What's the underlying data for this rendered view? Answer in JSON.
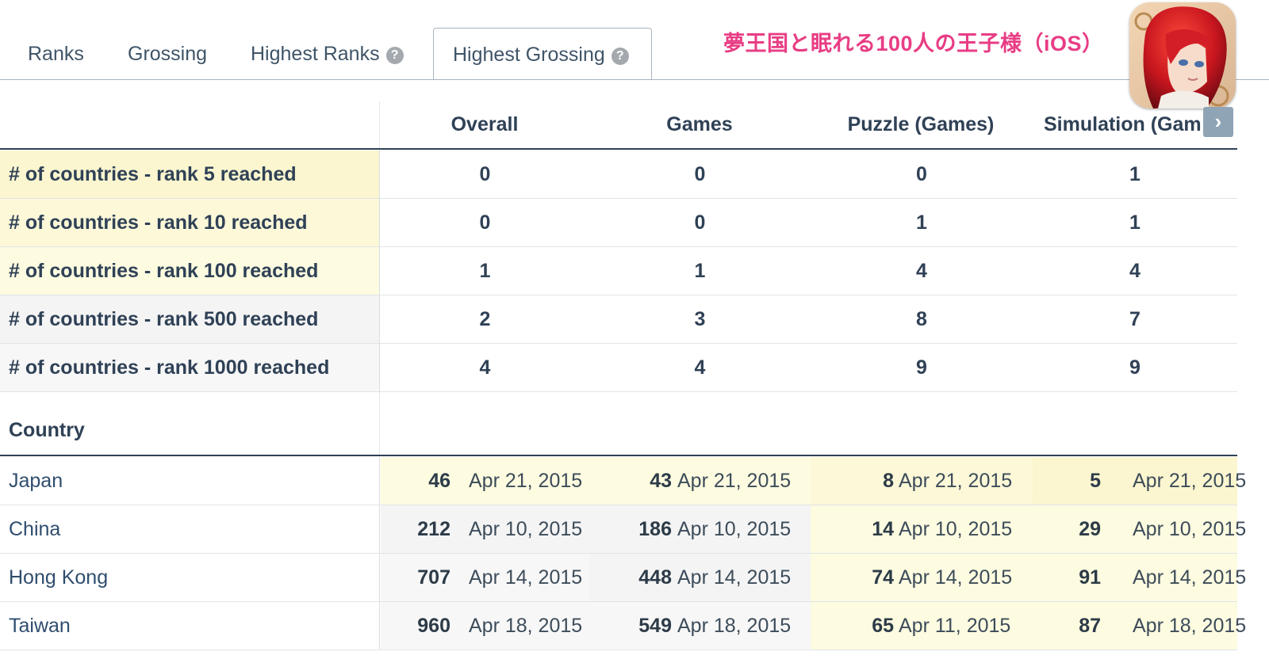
{
  "tabs": [
    {
      "label": "Ranks",
      "help": false,
      "active": false
    },
    {
      "label": "Grossing",
      "help": false,
      "active": false
    },
    {
      "label": "Highest Ranks",
      "help": true,
      "active": false
    },
    {
      "label": "Highest Grossing",
      "help": true,
      "active": true
    }
  ],
  "app": {
    "title": "夢王国と眠れる100人の王子様（iOS）",
    "icon": "app-icon-red-haired-prince"
  },
  "help_glyph": "?",
  "nav_arrow_glyph": "›",
  "columns": [
    "Overall",
    "Games",
    "Puzzle (Games)",
    "Simulation (Gam"
  ],
  "summary": [
    {
      "label": "# of countries - rank 5 reached",
      "values": [
        "0",
        "0",
        "0",
        "1"
      ]
    },
    {
      "label": "# of countries - rank 10 reached",
      "values": [
        "0",
        "0",
        "1",
        "1"
      ]
    },
    {
      "label": "# of countries - rank 100 reached",
      "values": [
        "1",
        "1",
        "4",
        "4"
      ]
    },
    {
      "label": "# of countries - rank 500 reached",
      "values": [
        "2",
        "3",
        "8",
        "7"
      ]
    },
    {
      "label": "# of countries - rank 1000 reached",
      "values": [
        "4",
        "4",
        "9",
        "9"
      ]
    }
  ],
  "country_header": "Country",
  "countries": [
    {
      "name": "Japan",
      "cells": [
        {
          "rank": "46",
          "date": "Apr 21, 2015"
        },
        {
          "rank": "43",
          "date": "Apr 21, 2015"
        },
        {
          "rank": "8",
          "date": "Apr 21, 2015"
        },
        {
          "rank": "5",
          "date": "Apr 21, 2015"
        }
      ]
    },
    {
      "name": "China",
      "cells": [
        {
          "rank": "212",
          "date": "Apr 10, 2015"
        },
        {
          "rank": "186",
          "date": "Apr 10, 2015"
        },
        {
          "rank": "14",
          "date": "Apr 10, 2015"
        },
        {
          "rank": "29",
          "date": "Apr 10, 2015"
        }
      ]
    },
    {
      "name": "Hong Kong",
      "cells": [
        {
          "rank": "707",
          "date": "Apr 14, 2015"
        },
        {
          "rank": "448",
          "date": "Apr 14, 2015"
        },
        {
          "rank": "74",
          "date": "Apr 14, 2015"
        },
        {
          "rank": "91",
          "date": "Apr 14, 2015"
        }
      ]
    },
    {
      "name": "Taiwan",
      "cells": [
        {
          "rank": "960",
          "date": "Apr 18, 2015"
        },
        {
          "rank": "549",
          "date": "Apr 18, 2015"
        },
        {
          "rank": "65",
          "date": "Apr 11, 2015"
        },
        {
          "rank": "87",
          "date": "Apr 18, 2015"
        }
      ]
    }
  ],
  "colors": {
    "accent": "#e83d84",
    "text": "#2f4156",
    "rank5": "#fbf6cf",
    "rank10": "#fcf8d8",
    "rank100": "#fdfbe0",
    "rank500": "#f4f4f4",
    "rank1000": "#f7f7f7",
    "plain": "#ffffff"
  }
}
